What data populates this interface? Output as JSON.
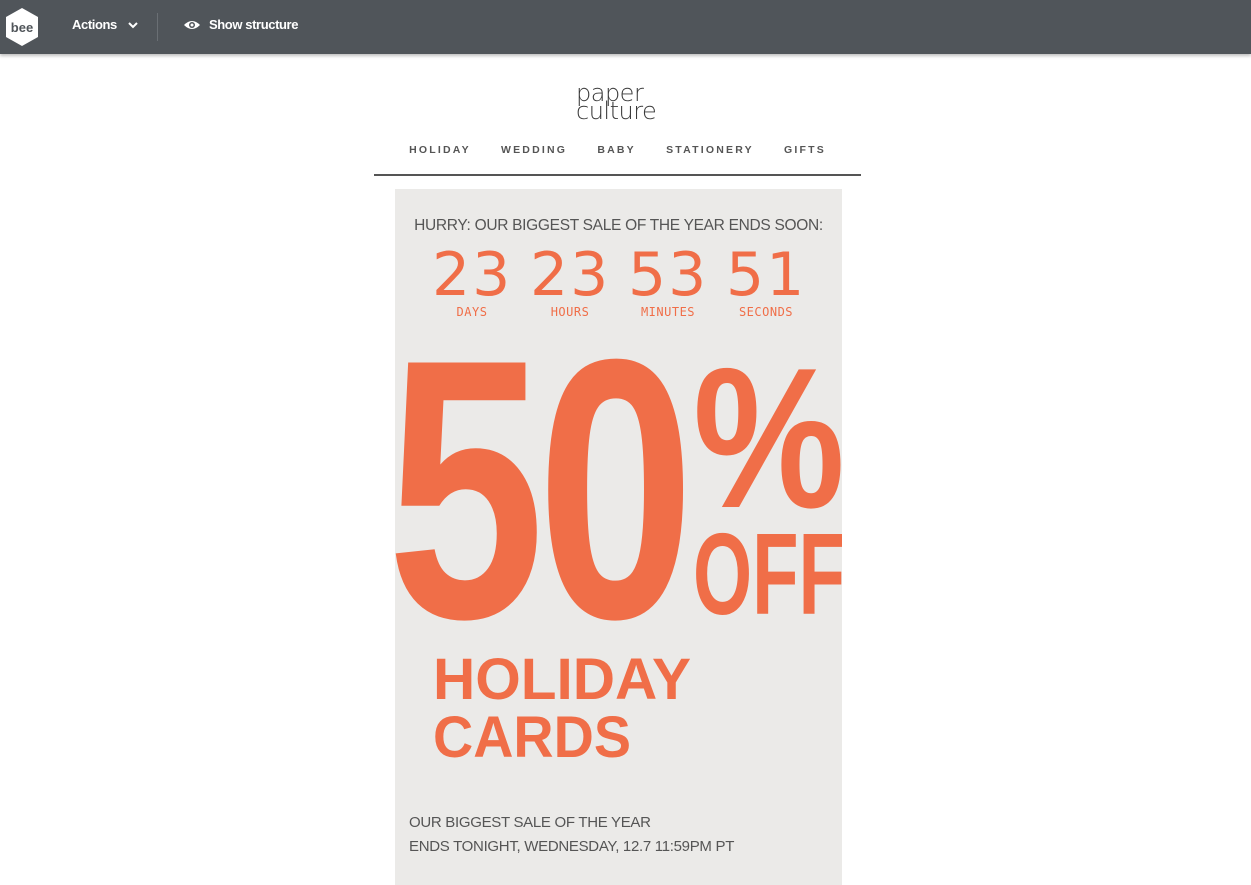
{
  "toolbar": {
    "logo_text": "bee",
    "actions_label": "Actions",
    "show_structure_label": "Show structure"
  },
  "email": {
    "brand": {
      "line1": "paper",
      "line2": "culture"
    },
    "nav": [
      "HOLIDAY",
      "WEDDING",
      "BABY",
      "STATIONERY",
      "GIFTS"
    ],
    "hurry_text": "HURRY: OUR BIGGEST SALE OF THE YEAR ENDS SOON:",
    "countdown": [
      {
        "value": "23",
        "label": "DAYS"
      },
      {
        "value": "23",
        "label": "HOURS"
      },
      {
        "value": "53",
        "label": "MINUTES"
      },
      {
        "value": "51",
        "label": "SECONDS"
      }
    ],
    "promo": {
      "amount": "50",
      "percent": "%",
      "off": "OFF",
      "line1": "HOLIDAY",
      "line2": "CARDS"
    },
    "footer": {
      "line1": "OUR BIGGEST SALE OF THE YEAR",
      "line2": "ENDS TONIGHT, WEDNESDAY, 12.7 11:59PM PT"
    }
  },
  "colors": {
    "toolbar_bg": "#50555a",
    "accent": "#f06e48",
    "panel_bg": "#ebeae8",
    "text_gray": "#555555"
  }
}
